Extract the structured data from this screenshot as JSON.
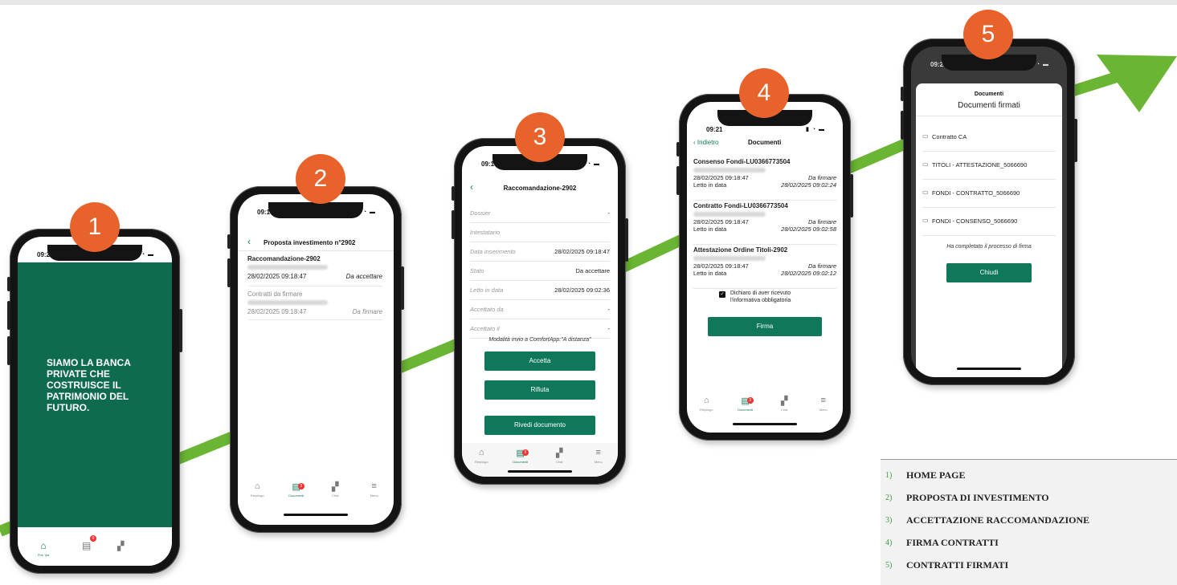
{
  "badges": [
    "1",
    "2",
    "3",
    "4",
    "5"
  ],
  "colors": {
    "arrow": "#6ab533",
    "badge": "#e8622b",
    "brand_green": "#10785a"
  },
  "phone1": {
    "time": "09:24",
    "headline": "SIAMO LA BANCA PRIVATE CHE COSTRUISCE IL PATRIMONIO DEL FUTURO.",
    "tab_home": "Prin 'ipa",
    "badge_count": "0"
  },
  "phone2": {
    "time": "09:19",
    "title": "Proposta investimento n°2902",
    "item1_title": "Raccomandazione-2902",
    "item1_date": "28/02/2025 09:18:47",
    "item1_status": "Da accettare",
    "item2_title": "Contratti da firmare",
    "item2_date": "28/02/2025 09:18:47",
    "item2_status": "Da firmare",
    "tabs": [
      "Riepilogo",
      "Documenti",
      "Chat",
      "Menu"
    ],
    "badge_count": "3"
  },
  "phone3": {
    "time": "09:19",
    "title": "Raccomandazione-2902",
    "fields": [
      {
        "label": "Dossier",
        "value": "-"
      },
      {
        "label": "Intestatario",
        "value": ""
      },
      {
        "label": "Data inserimento",
        "value": "28/02/2025 09:18:47"
      },
      {
        "label": "Stato",
        "value": "Da accettare"
      },
      {
        "label": "Letto in data",
        "value": "28/02/2025 09:02:36"
      },
      {
        "label": "Accettato da",
        "value": "-"
      },
      {
        "label": "Accettato il",
        "value": "-"
      }
    ],
    "modalita": "Modalità invio a ComfortApp:\"A distanza\"",
    "btn_accept": "Accetta",
    "btn_reject": "Rifiuta",
    "btn_review": "Rivedi documento",
    "tabs": [
      "Riepilogo",
      "Documenti",
      "Chat",
      "Menu"
    ],
    "badge_count": "3"
  },
  "phone4": {
    "time": "09:21",
    "back": "Indietro",
    "title": "Documenti",
    "docs": [
      {
        "title": "Consenso Fondi-LU0366773504",
        "date": "28/02/2025 09:18:47",
        "status": "Da firmare",
        "read_label": "Letto in data",
        "read_date": "28/02/2025 09:02:24"
      },
      {
        "title": "Contratto Fondi-LU0366773504",
        "date": "28/02/2025 09:18:47",
        "status": "Da firmare",
        "read_label": "Letto in data",
        "read_date": "28/02/2025 09:02:58"
      },
      {
        "title": "Attestazione Ordine Titoli-2902",
        "date": "28/02/2025 09:18:47",
        "status": "Da firmare",
        "read_label": "Letto in data",
        "read_date": "28/02/2025 09:02:12"
      }
    ],
    "declaration": "Dichiaro di aver ricevuto l'informativa obbligatoria",
    "btn_sign": "Firma",
    "tabs": [
      "Riepilogo",
      "Documenti",
      "Chat",
      "Menu"
    ],
    "badge_count": "3"
  },
  "phone5": {
    "time": "09:23",
    "header": "Documenti",
    "subheader": "Documenti firmati",
    "docs": [
      "Contratto CA",
      "TITOLI - ATTESTAZIONE_5066690",
      "FONDI - CONTRATTO_5066690",
      "FONDI - CONSENSO_5066690"
    ],
    "completed": "Ha completato il processo di firma",
    "btn_close": "Chiudi"
  },
  "legend": [
    {
      "num": "1)",
      "label": "HOME PAGE"
    },
    {
      "num": "2)",
      "label": "PROPOSTA DI INVESTIMENTO"
    },
    {
      "num": "3)",
      "label": "ACCETTAZIONE RACCOMANDAZIONE"
    },
    {
      "num": "4)",
      "label": "FIRMA CONTRATTI"
    },
    {
      "num": "5)",
      "label": "CONTRATTI FIRMATI"
    }
  ]
}
